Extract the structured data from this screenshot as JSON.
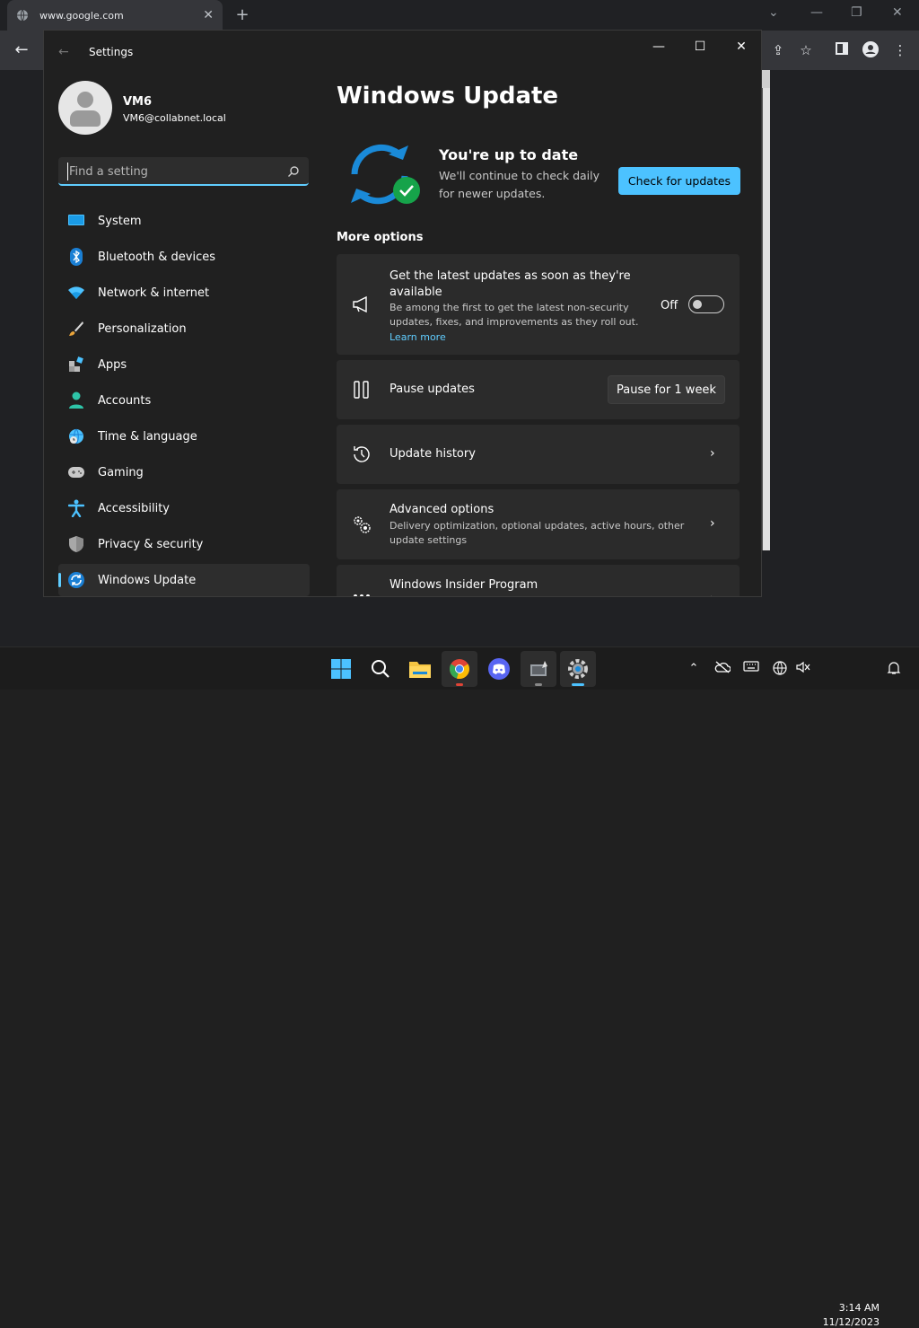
{
  "browser": {
    "tab_title": "www.google.com"
  },
  "window": {
    "title": "Settings"
  },
  "profile": {
    "name": "VM6",
    "email": "VM6@collabnet.local"
  },
  "search": {
    "placeholder": "Find a setting"
  },
  "nav": {
    "items": [
      {
        "label": "System",
        "icon": "monitor-icon"
      },
      {
        "label": "Bluetooth & devices",
        "icon": "bluetooth-icon"
      },
      {
        "label": "Network & internet",
        "icon": "wifi-icon"
      },
      {
        "label": "Personalization",
        "icon": "brush-icon"
      },
      {
        "label": "Apps",
        "icon": "apps-icon"
      },
      {
        "label": "Accounts",
        "icon": "person-icon"
      },
      {
        "label": "Time & language",
        "icon": "globe-clock-icon"
      },
      {
        "label": "Gaming",
        "icon": "gamepad-icon"
      },
      {
        "label": "Accessibility",
        "icon": "accessibility-icon"
      },
      {
        "label": "Privacy & security",
        "icon": "shield-icon"
      },
      {
        "label": "Windows Update",
        "icon": "sync-icon"
      }
    ],
    "active_index": 10
  },
  "main": {
    "page_title": "Windows Update",
    "status_title": "You're up to date",
    "status_sub": "We'll continue to check daily for newer updates.",
    "check_button": "Check for updates",
    "more_options": "More options",
    "latest_updates": {
      "title": "Get the latest updates as soon as they're available",
      "desc": "Be among the first to get the latest non-security updates, fixes, and improvements as they roll out.",
      "learn_more": "Learn more",
      "toggle_label": "Off"
    },
    "pause": {
      "title": "Pause updates",
      "button": "Pause for 1 week"
    },
    "history": {
      "title": "Update history"
    },
    "advanced": {
      "title": "Advanced options",
      "desc": "Delivery optimization, optional updates, active hours, other update settings"
    },
    "insider": {
      "title": "Windows Insider Program"
    }
  },
  "taskbar": {
    "time": "3:14 AM",
    "date": "11/12/2023"
  },
  "colors": {
    "accent": "#60cdff",
    "button": "#4cc2ff",
    "success": "#16a34a"
  }
}
